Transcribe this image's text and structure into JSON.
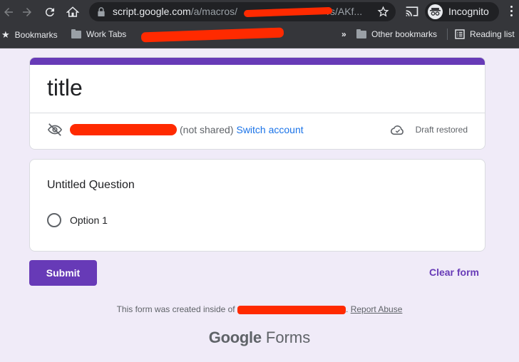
{
  "browser": {
    "url_host": "script.google.com",
    "url_path_visible": "/a/macros/",
    "url_tail": "/s/AKf...",
    "incognito_label": "Incognito",
    "bookmarks": [
      {
        "label": "Bookmarks",
        "icon": "star-icon"
      },
      {
        "label": "Work Tabs",
        "icon": "folder-icon"
      }
    ],
    "overflow_label": "»",
    "other_bookmarks": "Other bookmarks",
    "reading_list": "Reading list"
  },
  "form": {
    "accent_color": "#673ab7",
    "title": "title",
    "account_suffix": "(not shared)",
    "switch_account": "Switch account",
    "draft_status": "Draft restored",
    "question": {
      "title": "Untitled Question",
      "options": [
        "Option 1"
      ]
    },
    "submit_label": "Submit",
    "clear_label": "Clear form"
  },
  "footer": {
    "created_prefix": "This form was created inside of",
    "created_suffix": ".",
    "report_abuse": "Report Abuse",
    "brand_google": "Google",
    "brand_forms": "Forms"
  }
}
